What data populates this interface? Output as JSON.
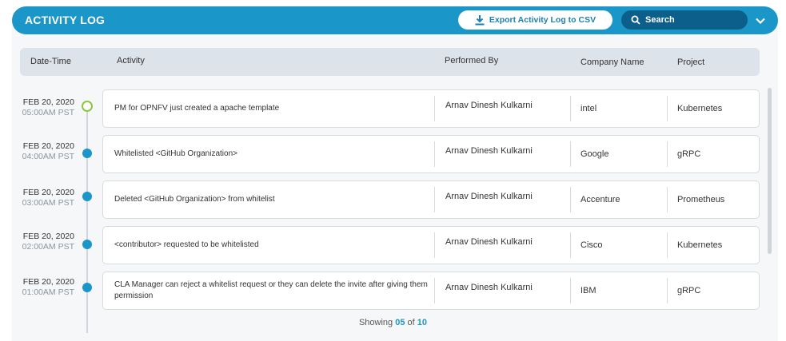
{
  "header": {
    "title": "ACTIVITY LOG",
    "export_label": "Export Activity Log to CSV",
    "search_placeholder": "Search"
  },
  "table": {
    "columns": [
      "Date-Time",
      "Activity",
      "Performed By",
      "Company Name",
      "Project"
    ],
    "rows": [
      {
        "date": "FEB 20, 2020",
        "time": "05:00AM PST",
        "activity": "PM for OPNFV just created a apache template",
        "performed_by": "Arnav Dinesh Kulkarni",
        "company": "intel",
        "project": "Kubernetes",
        "marker": "hollow"
      },
      {
        "date": "FEB 20, 2020",
        "time": "04:00AM PST",
        "activity": "Whitelisted <GitHub Organization>",
        "performed_by": "Arnav Dinesh Kulkarni",
        "company": "Google",
        "project": "gRPC",
        "marker": "filled"
      },
      {
        "date": "FEB 20, 2020",
        "time": "03:00AM PST",
        "activity": "Deleted <GitHub Organization> from whitelist",
        "performed_by": "Arnav Dinesh Kulkarni",
        "company": "Accenture",
        "project": "Prometheus",
        "marker": "filled"
      },
      {
        "date": "FEB 20, 2020",
        "time": "02:00AM PST",
        "activity": "<contributor> requested to be whitelisted",
        "performed_by": "Arnav Dinesh Kulkarni",
        "company": "Cisco",
        "project": "Kubernetes",
        "marker": "filled"
      },
      {
        "date": "FEB 20, 2020",
        "time": "01:00AM PST",
        "activity": "CLA Manager can reject a whitelist request or they can delete the invite after giving them permission",
        "performed_by": "Arnav Dinesh Kulkarni",
        "company": "IBM",
        "project": "gRPC",
        "marker": "filled"
      }
    ]
  },
  "pager": {
    "prefix": "Showing",
    "shown": "05",
    "of": "of",
    "total": "10"
  },
  "colors": {
    "accent": "#1b96c9",
    "search_bg": "#0c5f8a",
    "marker_first": "#8dc63f"
  },
  "icons": {
    "export": "download-icon",
    "search": "search-icon",
    "collapse": "chevron-down-icon"
  }
}
